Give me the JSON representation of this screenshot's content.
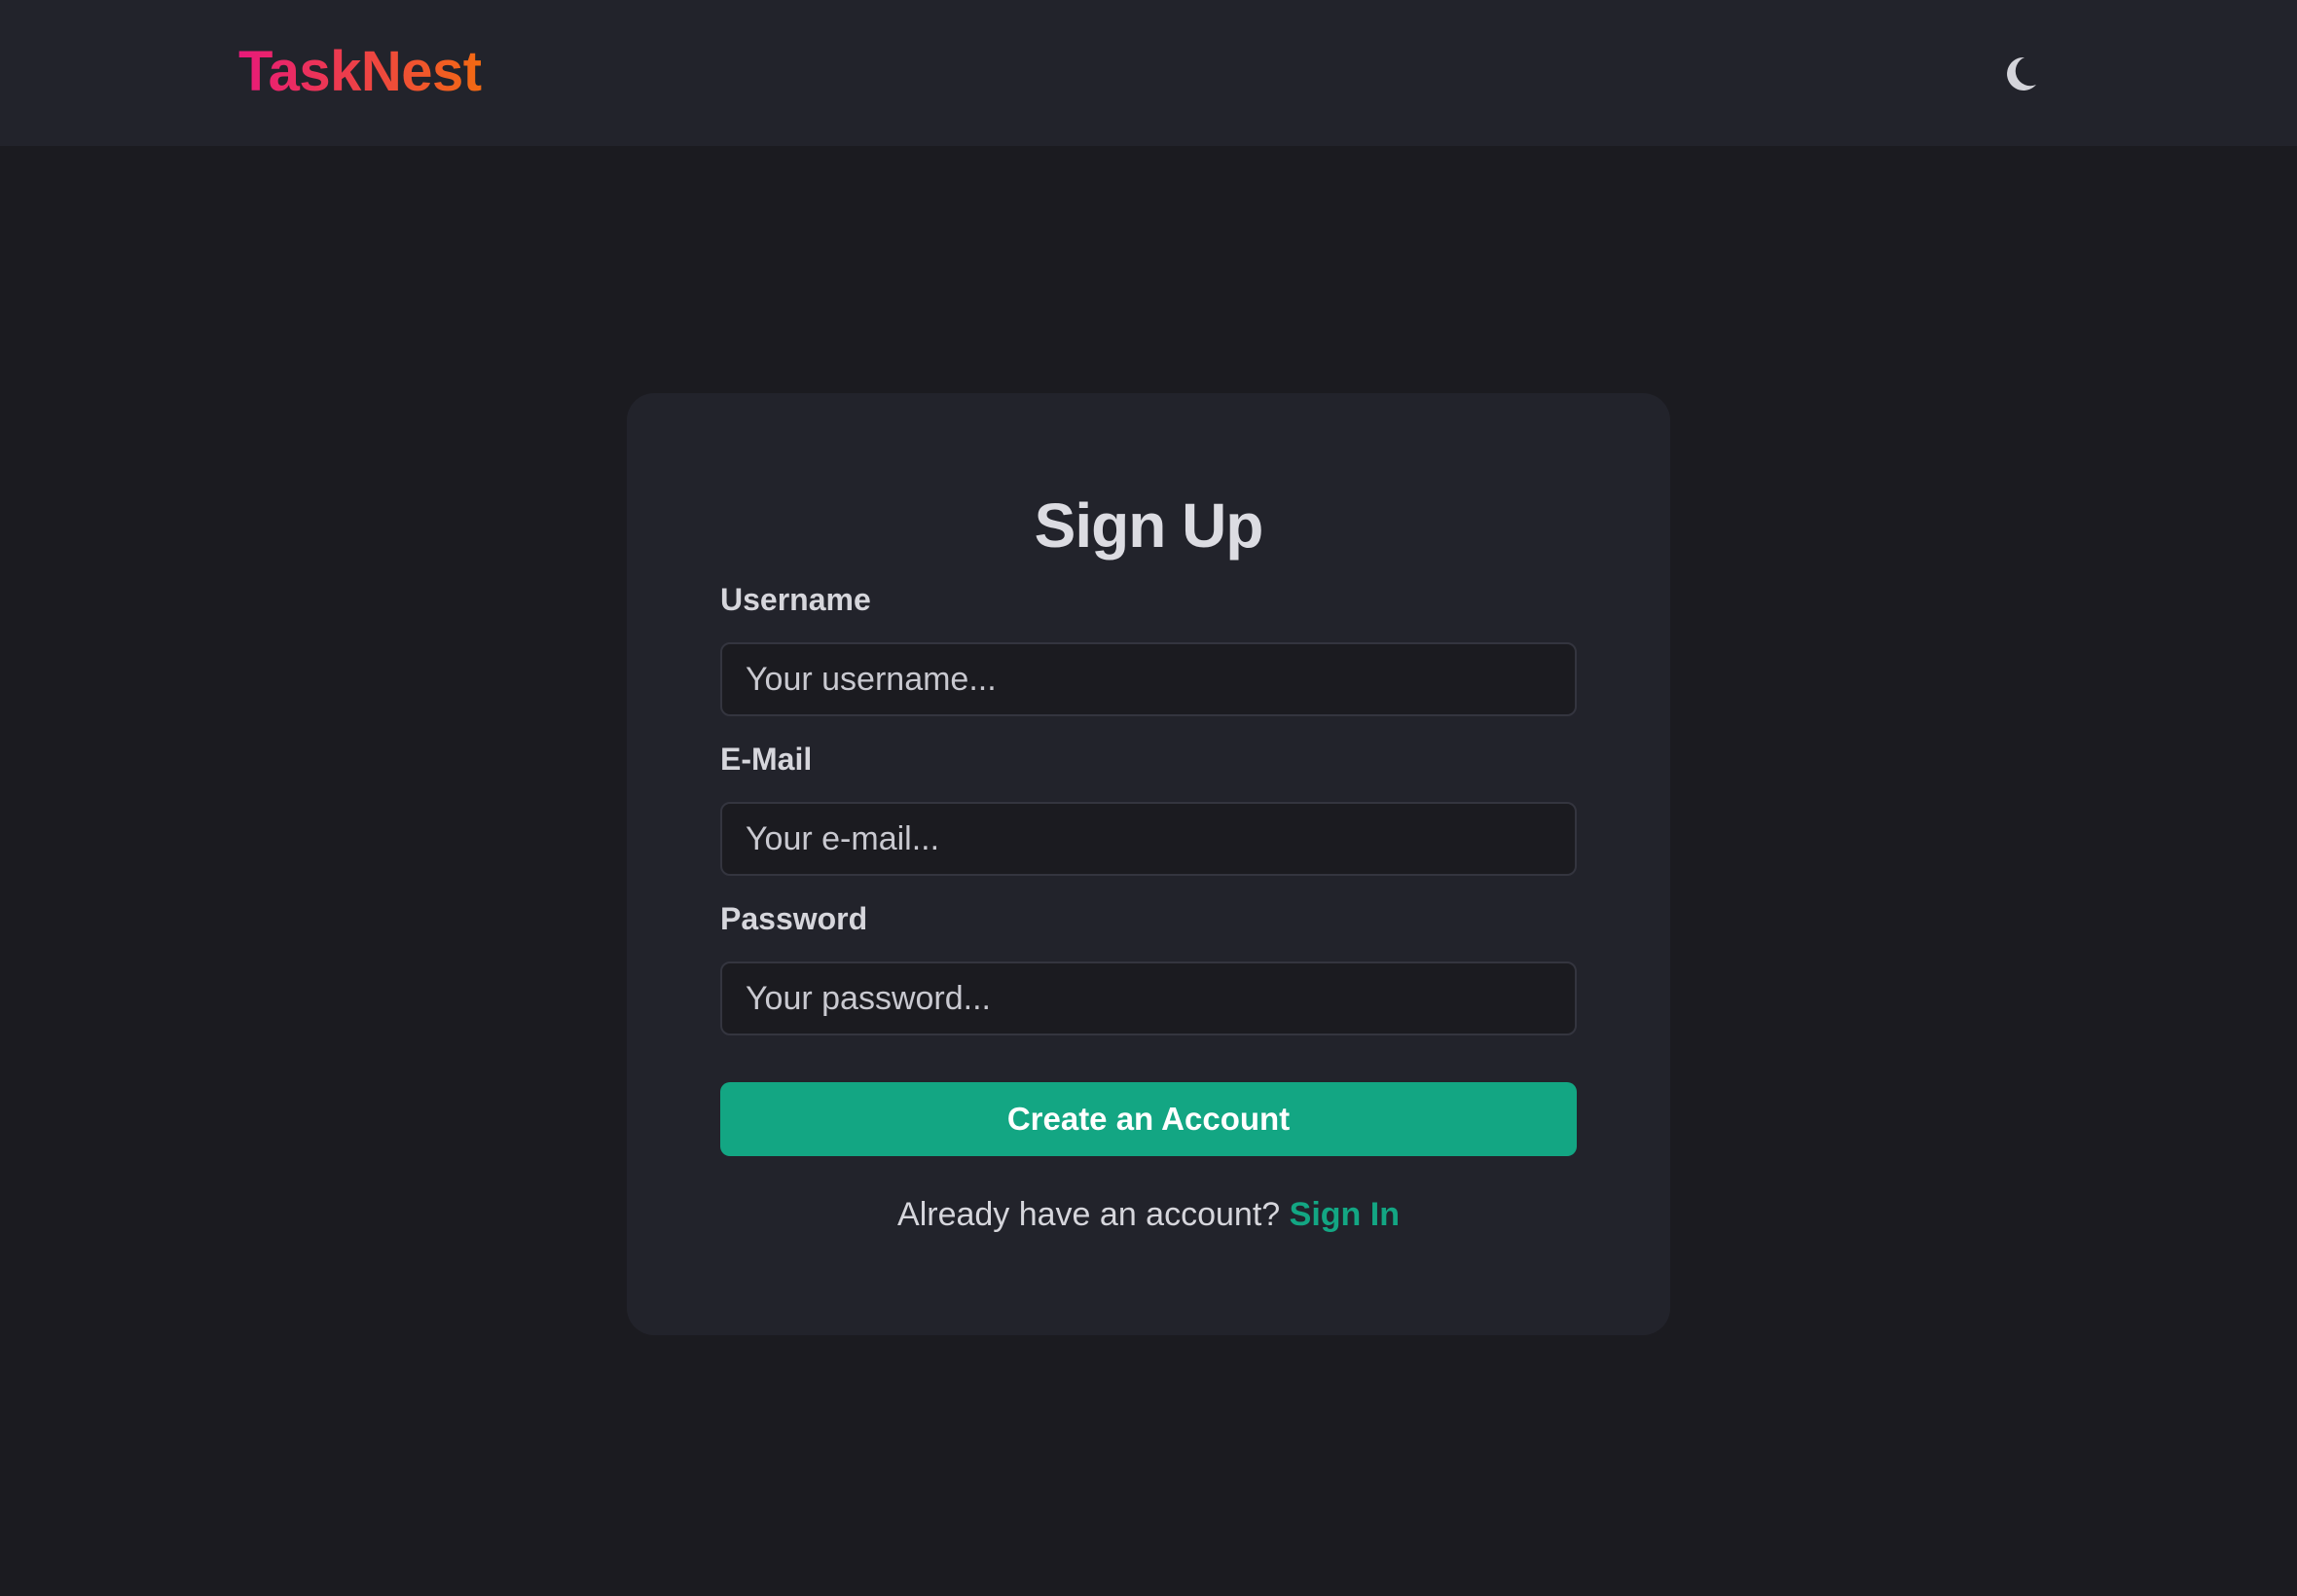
{
  "header": {
    "logo_text": "TaskNest",
    "theme_toggle_icon": "moon-icon"
  },
  "form": {
    "title": "Sign Up",
    "fields": [
      {
        "label": "Username",
        "placeholder": "Your username...",
        "value": ""
      },
      {
        "label": "E-Mail",
        "placeholder": "Your e-mail...",
        "value": ""
      },
      {
        "label": "Password",
        "placeholder": "Your password...",
        "value": ""
      }
    ],
    "submit_label": "Create an Account",
    "switch_prompt": "Already have an account?",
    "switch_link": "Sign In"
  },
  "colors": {
    "background": "#1b1b20",
    "surface": "#22232b",
    "accent": "#13a683",
    "logo_gradient_start": "#e8197a",
    "logo_gradient_end": "#f36a12"
  }
}
